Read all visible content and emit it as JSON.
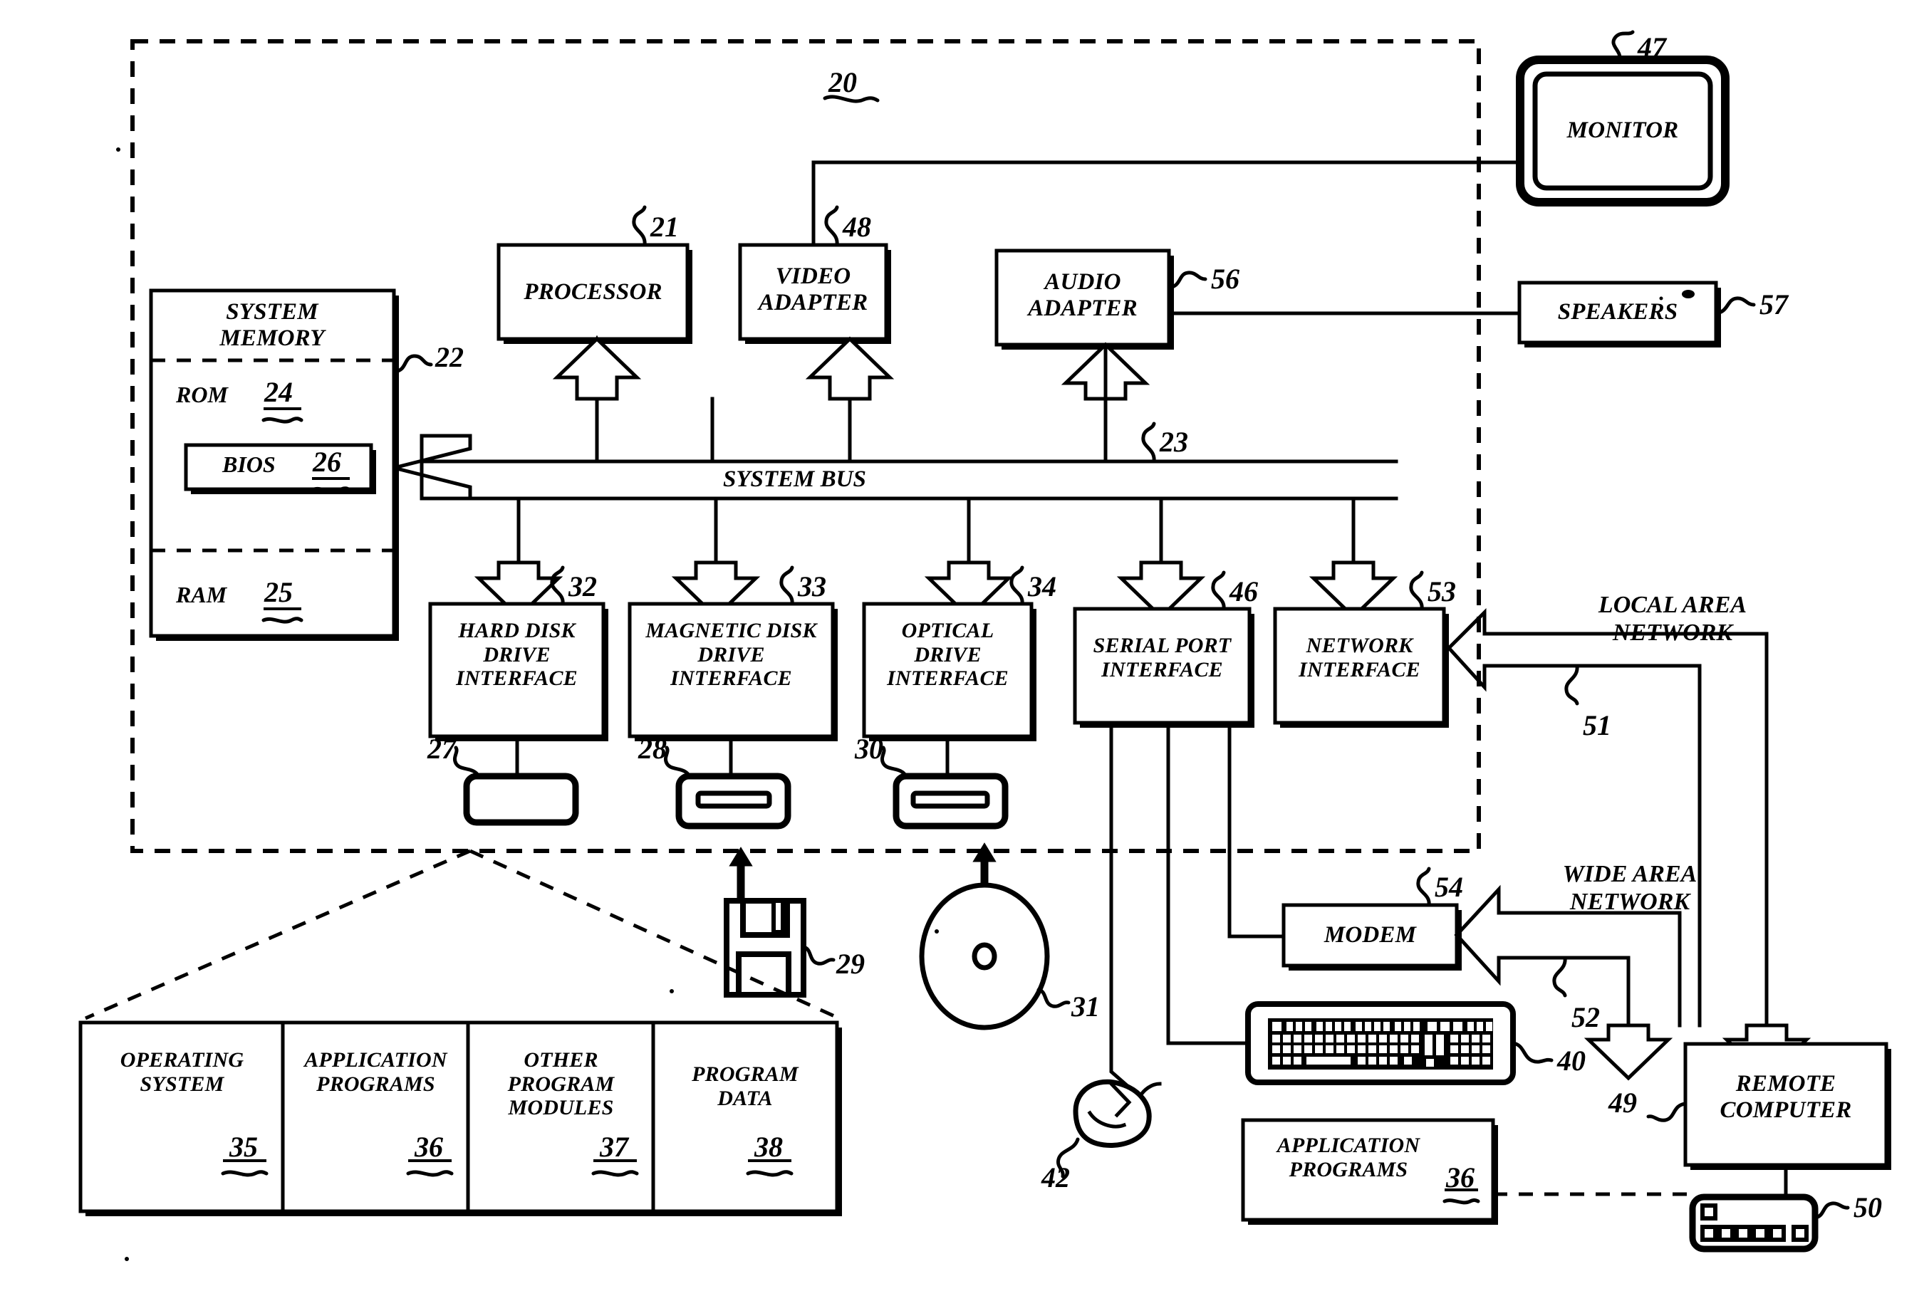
{
  "figure": {
    "system_ref": "20",
    "bus_label": "SYSTEM BUS",
    "bus_ref": "23"
  },
  "memory": {
    "title": "SYSTEM\nMEMORY",
    "ref": "22",
    "rom_label": "ROM",
    "rom_ref": "24",
    "bios_label": "BIOS",
    "bios_ref": "26",
    "ram_label": "RAM",
    "ram_ref": "25"
  },
  "core_blocks": [
    {
      "label": "PROCESSOR",
      "ref": "21"
    },
    {
      "label": "VIDEO\nADAPTER",
      "ref": "48"
    },
    {
      "label": "AUDIO\nADAPTER",
      "ref": "56"
    }
  ],
  "peripherals": [
    {
      "label": "MONITOR",
      "ref": "47"
    },
    {
      "label": "SPEAKERS",
      "ref": "57"
    }
  ],
  "interfaces": [
    {
      "label": "HARD DISK\nDRIVE\nINTERFACE",
      "ref": "32"
    },
    {
      "label": "MAGNETIC DISK\nDRIVE\nINTERFACE",
      "ref": "33"
    },
    {
      "label": "OPTICAL\nDRIVE\nINTERFACE",
      "ref": "34"
    },
    {
      "label": "SERIAL PORT\nINTERFACE",
      "ref": "46"
    },
    {
      "label": "NETWORK\nINTERFACE",
      "ref": "53"
    }
  ],
  "drives": [
    {
      "name": "hard-disk-drive",
      "ref": "27"
    },
    {
      "name": "magnetic-disk-drive",
      "ref": "28"
    },
    {
      "name": "optical-drive",
      "ref": "30"
    }
  ],
  "media": [
    {
      "name": "floppy-disk",
      "ref": "29"
    },
    {
      "name": "optical-disc",
      "ref": "31"
    }
  ],
  "storage_contents": [
    {
      "label": "OPERATING\nSYSTEM",
      "ref": "35"
    },
    {
      "label": "APPLICATION\nPROGRAMS",
      "ref": "36"
    },
    {
      "label": "OTHER\nPROGRAM\nMODULES",
      "ref": "37"
    },
    {
      "label": "PROGRAM\nDATA",
      "ref": "38"
    }
  ],
  "networks": {
    "lan_label": "LOCAL AREA\nNETWORK",
    "lan_ref": "51",
    "wan_label": "WIDE AREA\nNETWORK",
    "wan_ref": "52"
  },
  "remote": {
    "modem_label": "MODEM",
    "modem_ref": "54",
    "remote_computer_label": "REMOTE\nCOMPUTER",
    "remote_computer_ref": "49",
    "remote_storage_ref": "50",
    "remote_apps_label": "APPLICATION\nPROGRAMS",
    "remote_apps_ref": "36"
  },
  "input_devices": [
    {
      "name": "keyboard",
      "ref": "40"
    },
    {
      "name": "mouse",
      "ref": "42"
    }
  ],
  "colors": {
    "ink": "#000000",
    "paper": "#ffffff"
  }
}
